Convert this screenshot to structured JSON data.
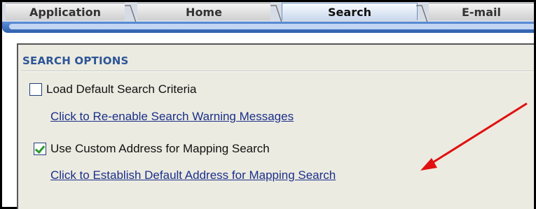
{
  "tabs": [
    {
      "label": "Application",
      "active": false
    },
    {
      "label": "Home",
      "active": false
    },
    {
      "label": "Search",
      "active": true
    },
    {
      "label": "E-mail",
      "active": false
    }
  ],
  "section": {
    "title": "SEARCH OPTIONS"
  },
  "options": [
    {
      "label": "Load Default Search Criteria",
      "checked": false,
      "link": "Click to Re-enable Search Warning Messages"
    },
    {
      "label": "Use Custom Address for Mapping Search",
      "checked": true,
      "link": "Click to Establish Default Address for Mapping Search"
    }
  ],
  "colors": {
    "accent": "#2d5596",
    "link": "#1a2f8a",
    "panel": "#ecebe1",
    "annotation_arrow": "#e01010"
  },
  "icons": {
    "annotation": "red-arrow-icon"
  }
}
